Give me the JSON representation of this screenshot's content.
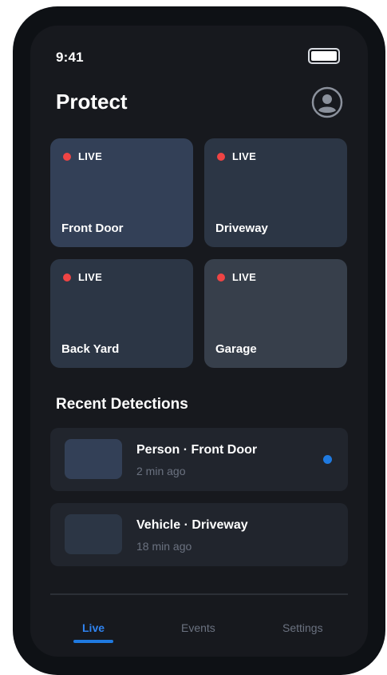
{
  "status_bar": {
    "time": "9:41"
  },
  "header": {
    "title": "Protect"
  },
  "cameras": [
    {
      "name": "Front Door",
      "status": "LIVE"
    },
    {
      "name": "Driveway",
      "status": "LIVE"
    },
    {
      "name": "Back Yard",
      "status": "LIVE"
    },
    {
      "name": "Garage",
      "status": "LIVE"
    }
  ],
  "recent": {
    "title": "Recent Detections",
    "items": [
      {
        "title": "Person · Front Door",
        "time": "2 min ago",
        "unread": true
      },
      {
        "title": "Vehicle · Driveway",
        "time": "18 min ago",
        "unread": false
      }
    ]
  },
  "nav": {
    "tabs": [
      {
        "label": "Live",
        "active": true
      },
      {
        "label": "Events",
        "active": false
      },
      {
        "label": "Settings",
        "active": false
      }
    ]
  },
  "colors": {
    "accent": "#1f7ae0",
    "live": "#ef4444",
    "background": "#17191e"
  },
  "icons": {
    "profile": "user-circle-icon",
    "battery": "battery-icon"
  }
}
